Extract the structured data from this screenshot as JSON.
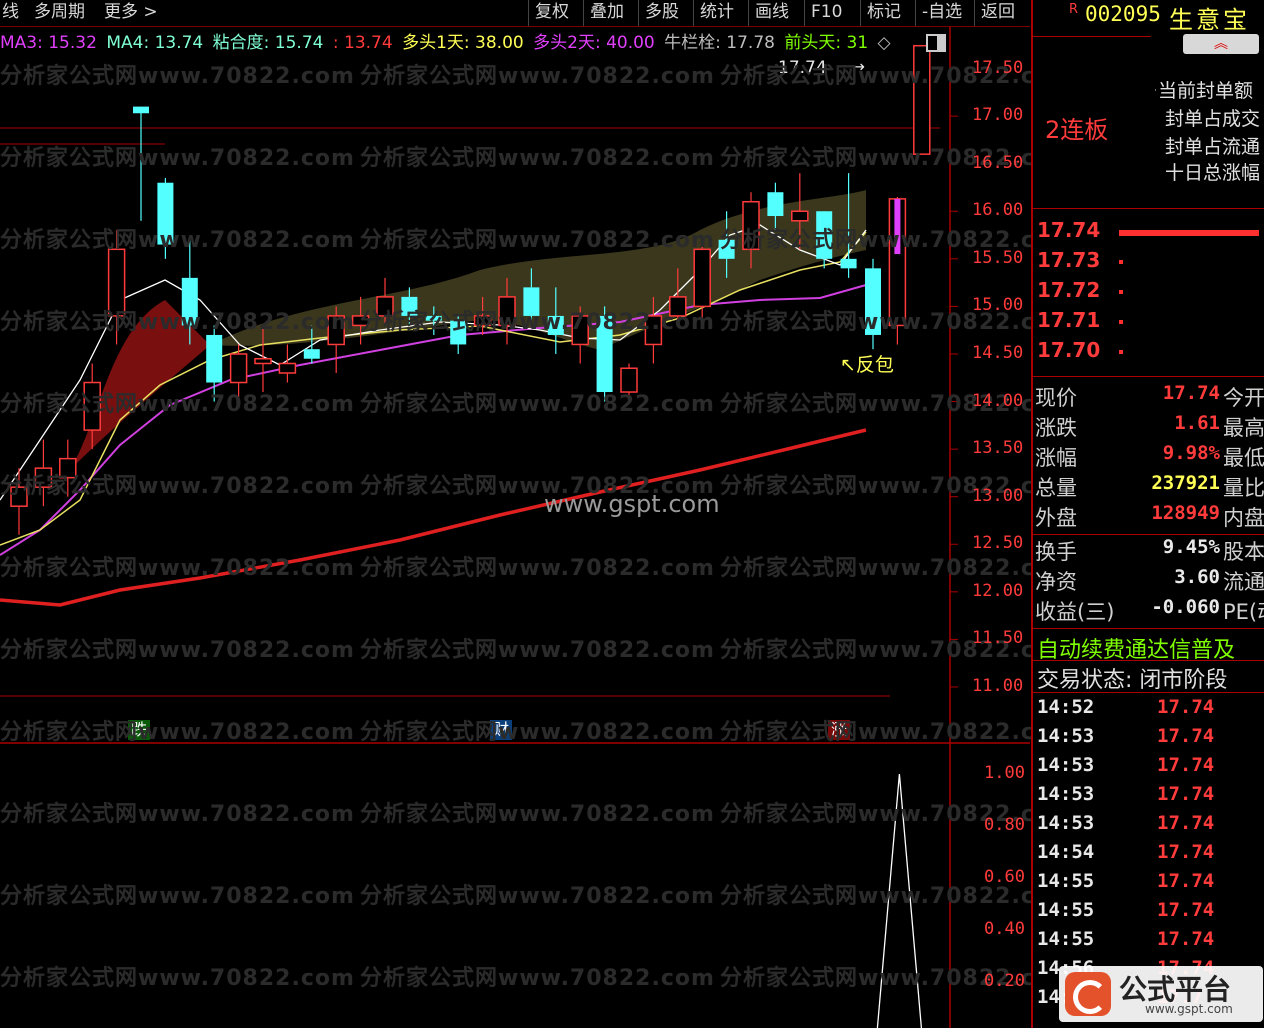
{
  "toolbar": {
    "left_items": [
      "线",
      "多周期",
      "更多 >"
    ],
    "buttons": [
      "复权",
      "叠加",
      "多股",
      "统计",
      "画线",
      "F10",
      "标记",
      "-自选",
      "返回"
    ]
  },
  "indicators": [
    {
      "label": "MA3: 15.32",
      "color": "#e040fb"
    },
    {
      "label": "MA4: 13.74",
      "color": "#7fffd4"
    },
    {
      "label": "粘合度: 15.74",
      "color": "#7fffd4"
    },
    {
      "label": ": 13.74",
      "color": "#ff3b3b"
    },
    {
      "label": "多头1天: 38.00",
      "color": "#ffff55"
    },
    {
      "label": "多头2天: 40.00",
      "color": "#e040fb"
    },
    {
      "label": "牛栏栓: 17.78",
      "color": "#bdbdbd"
    },
    {
      "label": "前头天: 31",
      "color": "#7fff00"
    }
  ],
  "price_axis": [
    "17.50",
    "17.00",
    "16.50",
    "16.00",
    "15.50",
    "15.00",
    "14.50",
    "14.00",
    "13.50",
    "13.00",
    "12.50",
    "12.00",
    "11.50",
    "11.00"
  ],
  "sub_axis": [
    "1.00",
    "0.80",
    "0.60",
    "0.40",
    "0.20"
  ],
  "annotations": {
    "last_price": "17.74",
    "fanbao": "反包",
    "watermark_center": "www.gspt.com",
    "watermark_repeat": "分析家公式网www.70822.com",
    "markers": [
      "跌",
      "财",
      "涨"
    ]
  },
  "chart_data": {
    "type": "candlestick",
    "ylim": [
      10.8,
      17.8
    ],
    "candles": [
      {
        "o": 12.9,
        "c": 13.1,
        "h": 13.3,
        "l": 12.6,
        "up": true
      },
      {
        "o": 13.1,
        "c": 13.3,
        "h": 13.6,
        "l": 12.9,
        "up": true
      },
      {
        "o": 13.2,
        "c": 13.4,
        "h": 13.6,
        "l": 13.0,
        "up": true
      },
      {
        "o": 13.7,
        "c": 14.2,
        "h": 14.4,
        "l": 13.5,
        "up": true
      },
      {
        "o": 14.9,
        "c": 15.6,
        "h": 15.8,
        "l": 14.6,
        "up": true
      },
      {
        "o": 17.1,
        "c": 17.03,
        "h": 17.1,
        "l": 15.9,
        "up": false
      },
      {
        "o": 16.3,
        "c": 15.65,
        "h": 16.35,
        "l": 15.5,
        "up": false
      },
      {
        "o": 15.3,
        "c": 14.8,
        "h": 15.7,
        "l": 14.6,
        "up": false
      },
      {
        "o": 14.7,
        "c": 14.2,
        "h": 14.8,
        "l": 14.0,
        "up": false
      },
      {
        "o": 14.2,
        "c": 14.5,
        "h": 14.6,
        "l": 14.0,
        "up": true
      },
      {
        "o": 14.4,
        "c": 14.45,
        "h": 14.8,
        "l": 14.1,
        "up": true
      },
      {
        "o": 14.3,
        "c": 14.4,
        "h": 14.6,
        "l": 14.2,
        "up": true
      },
      {
        "o": 14.55,
        "c": 14.45,
        "h": 14.8,
        "l": 14.4,
        "up": false
      },
      {
        "o": 14.6,
        "c": 14.9,
        "h": 15.0,
        "l": 14.3,
        "up": true
      },
      {
        "o": 14.8,
        "c": 14.9,
        "h": 15.1,
        "l": 14.6,
        "up": true
      },
      {
        "o": 14.9,
        "c": 15.1,
        "h": 15.3,
        "l": 14.8,
        "up": true
      },
      {
        "o": 15.1,
        "c": 14.9,
        "h": 15.2,
        "l": 14.8,
        "up": false
      },
      {
        "o": 14.9,
        "c": 14.85,
        "h": 15.0,
        "l": 14.7,
        "up": false
      },
      {
        "o": 14.85,
        "c": 14.6,
        "h": 14.9,
        "l": 14.5,
        "up": false
      },
      {
        "o": 14.8,
        "c": 14.9,
        "h": 15.1,
        "l": 14.7,
        "up": true
      },
      {
        "o": 14.8,
        "c": 15.1,
        "h": 15.3,
        "l": 14.6,
        "up": true
      },
      {
        "o": 15.2,
        "c": 14.9,
        "h": 15.4,
        "l": 14.8,
        "up": false
      },
      {
        "o": 14.9,
        "c": 14.7,
        "h": 15.2,
        "l": 14.5,
        "up": false
      },
      {
        "o": 14.6,
        "c": 14.9,
        "h": 15.0,
        "l": 14.4,
        "up": true
      },
      {
        "o": 14.9,
        "c": 14.1,
        "h": 15.0,
        "l": 14.0,
        "up": false
      },
      {
        "o": 14.1,
        "c": 14.35,
        "h": 14.4,
        "l": 14.0,
        "up": true
      },
      {
        "o": 14.6,
        "c": 14.9,
        "h": 15.1,
        "l": 14.4,
        "up": true
      },
      {
        "o": 14.9,
        "c": 15.1,
        "h": 15.4,
        "l": 14.8,
        "up": true
      },
      {
        "o": 15.0,
        "c": 15.6,
        "h": 15.7,
        "l": 14.8,
        "up": true
      },
      {
        "o": 15.7,
        "c": 15.5,
        "h": 16.0,
        "l": 15.3,
        "up": false
      },
      {
        "o": 15.6,
        "c": 16.1,
        "h": 16.2,
        "l": 15.4,
        "up": true
      },
      {
        "o": 16.2,
        "c": 15.95,
        "h": 16.3,
        "l": 15.8,
        "up": false
      },
      {
        "o": 15.9,
        "c": 16.0,
        "h": 16.4,
        "l": 15.6,
        "up": true
      },
      {
        "o": 16.0,
        "c": 15.5,
        "h": 16.0,
        "l": 15.4,
        "up": false
      },
      {
        "o": 15.5,
        "c": 15.4,
        "h": 16.4,
        "l": 15.3,
        "up": false
      },
      {
        "o": 15.4,
        "c": 14.7,
        "h": 15.5,
        "l": 14.55,
        "up": false
      },
      {
        "o": 14.8,
        "c": 16.13,
        "h": 16.15,
        "l": 14.6,
        "up": true
      },
      {
        "o": 16.6,
        "c": 17.74,
        "h": 17.74,
        "l": 16.6,
        "up": true
      }
    ],
    "sub_indicator": [
      0,
      0,
      0,
      0,
      0,
      0,
      0,
      0,
      0,
      0,
      0,
      0,
      0,
      0,
      0,
      0,
      0,
      0,
      0,
      0,
      0,
      0,
      0,
      0,
      0,
      0,
      0,
      0,
      0,
      0,
      0,
      0,
      0,
      0,
      0,
      0,
      1.0,
      0
    ]
  },
  "right_panel": {
    "code_prefix": "R",
    "code": "002095",
    "name": "生意宝",
    "limit_label": "2连板",
    "info_lines": [
      "当前封单额",
      "封单占成交",
      "封单占流通",
      "十日总涨幅"
    ],
    "order_book": [
      {
        "price": "17.74"
      },
      {
        "price": "17.73"
      },
      {
        "price": "17.72"
      },
      {
        "price": "17.71"
      },
      {
        "price": "17.70"
      }
    ],
    "quote": [
      {
        "label": "现价",
        "value": "17.74",
        "tail": "今开",
        "vcolor": "red"
      },
      {
        "label": "涨跌",
        "value": "1.61",
        "tail": "最高",
        "vcolor": "red"
      },
      {
        "label": "涨幅",
        "value": "9.98%",
        "tail": "最低",
        "vcolor": "red"
      },
      {
        "label": "总量",
        "value": "237921",
        "tail": "量比",
        "vcolor": "yel"
      },
      {
        "label": "外盘",
        "value": "128949",
        "tail": "内盘",
        "vcolor": "red"
      }
    ],
    "fund": [
      {
        "label": "换手",
        "value": "9.45%",
        "tail": "股本"
      },
      {
        "label": "净资",
        "value": "3.60",
        "tail": "流通"
      },
      {
        "label": "收益(三)",
        "value": "-0.060",
        "tail": "PE(动"
      }
    ],
    "promo": "自动续费通达信普及",
    "trade_status": "交易状态: 闭市阶段",
    "ticks": [
      {
        "time": "14:52",
        "price": "17.74"
      },
      {
        "time": "14:53",
        "price": "17.74"
      },
      {
        "time": "14:53",
        "price": "17.74"
      },
      {
        "time": "14:53",
        "price": "17.74"
      },
      {
        "time": "14:53",
        "price": "17.74"
      },
      {
        "time": "14:54",
        "price": "17.74"
      },
      {
        "time": "14:55",
        "price": "17.74"
      },
      {
        "time": "14:55",
        "price": "17.74"
      },
      {
        "time": "14:55",
        "price": "17.74"
      },
      {
        "time": "14:56",
        "price": "17.74"
      },
      {
        "time": "14:5",
        "price": "17.7"
      }
    ],
    "logo_text": "公式平台",
    "logo_url_text": "www.gspt.com"
  }
}
